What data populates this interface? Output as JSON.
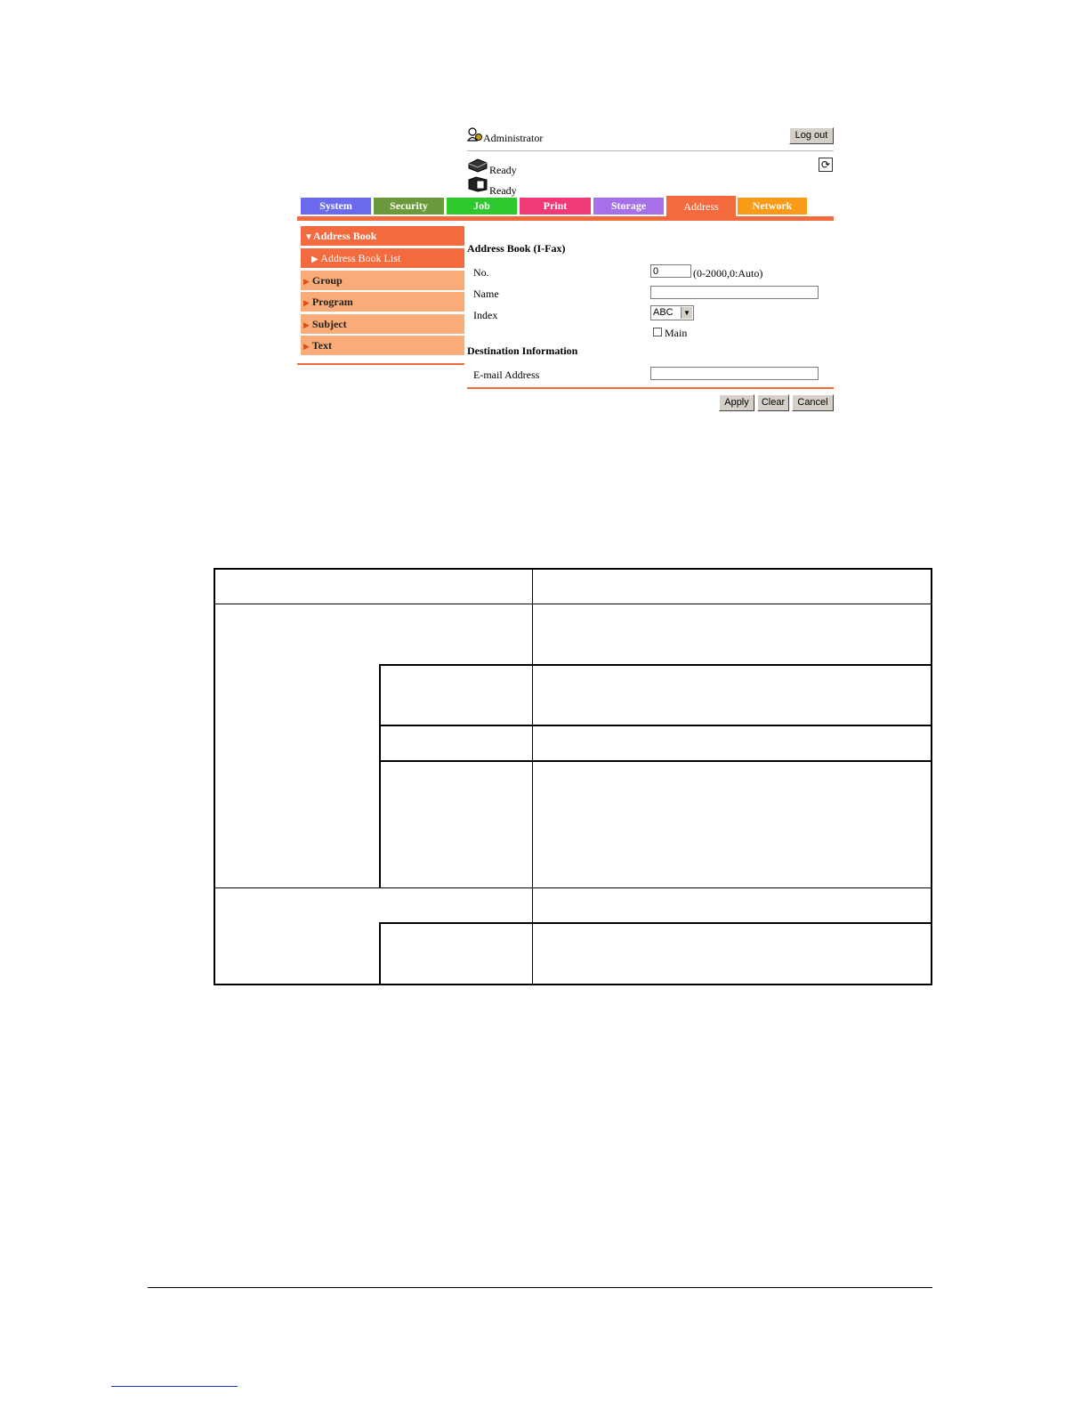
{
  "header": {
    "user_label": "Administrator",
    "logout_label": "Log out",
    "status": [
      "Ready",
      "Ready"
    ]
  },
  "tabs": [
    {
      "label": "System",
      "color": "#6a6aef"
    },
    {
      "label": "Security",
      "color": "#6b9a3c"
    },
    {
      "label": "Job",
      "color": "#2ec82e"
    },
    {
      "label": "Print",
      "color": "#f03a78"
    },
    {
      "label": "Storage",
      "color": "#a670e8"
    },
    {
      "label": "Address",
      "color": "#f26a3d",
      "active": true
    },
    {
      "label": "Network",
      "color": "#f99b16"
    }
  ],
  "menu": {
    "items": [
      {
        "label": "Address Book"
      },
      {
        "label": "Address Book List"
      },
      {
        "label": "Group"
      },
      {
        "label": "Program"
      },
      {
        "label": "Subject"
      },
      {
        "label": "Text"
      }
    ]
  },
  "form": {
    "title": "Address Book (I-Fax)",
    "no_label": "No.",
    "no_value": "0",
    "no_hint": "(0-2000,0:Auto)",
    "name_label": "Name",
    "name_value": "",
    "index_label": "Index",
    "index_value": "ABC",
    "main_label": "Main",
    "dest_title": "Destination Information",
    "email_label": "E-mail Address",
    "email_value": "",
    "apply_label": "Apply",
    "clear_label": "Clear",
    "cancel_label": "Cancel"
  },
  "colors": {
    "accent": "#f26a3d",
    "menu_light": "#f9ac78"
  }
}
